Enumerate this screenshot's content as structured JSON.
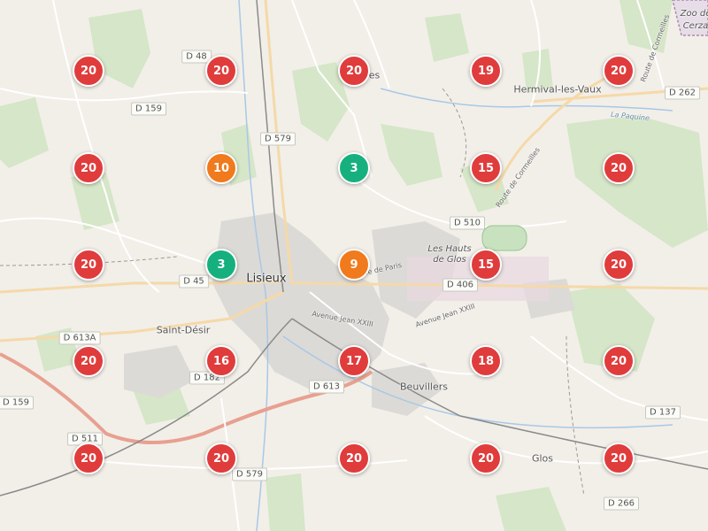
{
  "colors": {
    "high": "#e03c3c",
    "medium": "#f07a1c",
    "low": "#16b07e",
    "background": "#f2efe9",
    "forest": "#d6e6c8",
    "urban": "#dcdad6",
    "water": "#a8c8e6"
  },
  "places": {
    "lisieux": "Lisieux",
    "saint_desir": "Saint-Désir",
    "beuvillers": "Beuvillers",
    "hermival": "Hermival-les-Vaux",
    "glos": "Glos",
    "houts": "Les Hauts de Glos",
    "zoo_line1": "Zoo de",
    "zoo_line2": "Cerza",
    "paquine": "La Paquine",
    "fragment_es": "es"
  },
  "roads": {
    "d48": "D 48",
    "d159a": "D 159",
    "d579a": "D 579",
    "d262": "D 262",
    "d510": "D 510",
    "d45": "D 45",
    "d406": "D 406",
    "d613a": "D 613A",
    "d182": "D 182",
    "d613": "D 613",
    "d159b": "D 159",
    "d137": "D 137",
    "d511": "D 511",
    "d579b": "D 579",
    "d266": "D 266"
  },
  "streets": {
    "av_jean_xxiii_a": "Avenue Jean XXIII",
    "av_jean_xxiii_b": "Avenue Jean XXIII",
    "route_cormeilles_a": "Route de Cormeilles",
    "route_cormeilles_b": "Route de Cormeilles",
    "rue_paris": "Rue de Paris"
  },
  "clusters": [
    {
      "count": "20",
      "level": "high"
    },
    {
      "count": "20",
      "level": "high"
    },
    {
      "count": "20",
      "level": "high"
    },
    {
      "count": "19",
      "level": "high"
    },
    {
      "count": "20",
      "level": "high"
    },
    {
      "count": "20",
      "level": "high"
    },
    {
      "count": "10",
      "level": "medium"
    },
    {
      "count": "3",
      "level": "low"
    },
    {
      "count": "15",
      "level": "high"
    },
    {
      "count": "20",
      "level": "high"
    },
    {
      "count": "20",
      "level": "high"
    },
    {
      "count": "3",
      "level": "low"
    },
    {
      "count": "9",
      "level": "medium"
    },
    {
      "count": "15",
      "level": "high"
    },
    {
      "count": "20",
      "level": "high"
    },
    {
      "count": "20",
      "level": "high"
    },
    {
      "count": "16",
      "level": "high"
    },
    {
      "count": "17",
      "level": "high"
    },
    {
      "count": "18",
      "level": "high"
    },
    {
      "count": "20",
      "level": "high"
    },
    {
      "count": "20",
      "level": "high"
    },
    {
      "count": "20",
      "level": "high"
    },
    {
      "count": "20",
      "level": "high"
    },
    {
      "count": "20",
      "level": "high"
    },
    {
      "count": "20",
      "level": "high"
    }
  ]
}
